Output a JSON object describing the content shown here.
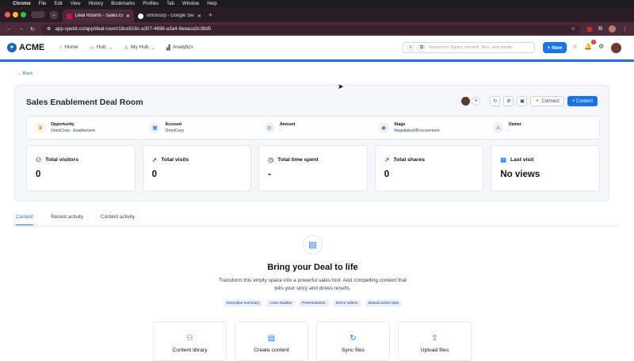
{
  "os_menubar": {
    "app": "Chrome",
    "items": [
      "File",
      "Edit",
      "View",
      "History",
      "Bookmarks",
      "Profiles",
      "Tab",
      "Window",
      "Help"
    ]
  },
  "browser": {
    "tabs": [
      {
        "title": "Deal Rooms - Sales Enableme",
        "active": true
      },
      {
        "title": "omnicorp - Google Search",
        "active": false
      }
    ],
    "url": "app.spekit.co/app/deal-room/18ce518c-a307-4698-a3a4-9eeaca3c38d5"
  },
  "app_nav": {
    "brand": "ACME",
    "items": [
      {
        "label": "Home",
        "icon": "home-icon"
      },
      {
        "label": "Hub",
        "icon": "folder-icon",
        "dropdown": true
      },
      {
        "label": "My Hub",
        "icon": "user-icon",
        "dropdown": true
      },
      {
        "label": "Analytics",
        "icon": "chart-icon"
      }
    ],
    "search_placeholder": "Search for Topics, content, files, and media",
    "new_label": "+ New",
    "notification_count": "1"
  },
  "back_label": "← Back",
  "deal_room": {
    "title": "Sales Enablement Deal Room",
    "connect_label": "Connect",
    "content_label": "+ Content",
    "details": [
      {
        "label": "Opportunity",
        "value": "OmniCorp - Enablement",
        "icon": "crown-icon"
      },
      {
        "label": "Account",
        "value": "OmniCorp",
        "icon": "building-icon"
      },
      {
        "label": "Amount",
        "value": "-",
        "icon": "dollar-icon"
      },
      {
        "label": "Stage",
        "value": "Negotiation/Procurement",
        "icon": "target-icon"
      },
      {
        "label": "Owner",
        "value": "-",
        "icon": "user-icon"
      }
    ],
    "stats": [
      {
        "label": "Total visitors",
        "value": "0",
        "icon": "users-icon"
      },
      {
        "label": "Total visits",
        "value": "0",
        "icon": "cursor-icon"
      },
      {
        "label": "Total time spent",
        "value": "-",
        "icon": "timer-icon"
      },
      {
        "label": "Total shares",
        "value": "0",
        "icon": "share-icon"
      },
      {
        "label": "Last visit",
        "value": "No views",
        "icon": "calendar-icon"
      }
    ]
  },
  "content_tabs": [
    {
      "label": "Content",
      "active": true
    },
    {
      "label": "Recent activity",
      "active": false
    },
    {
      "label": "Content activity",
      "active": false
    }
  ],
  "empty_state": {
    "title": "Bring your Deal to life",
    "description": "Transform this empty space into a powerful sales tool. Add compelling content that tells your story and drives results.",
    "chips": [
      "Executive summary",
      "Case studies",
      "Presentations",
      "Demo videos",
      "Mutual action plan"
    ],
    "cards": [
      {
        "label": "Content library",
        "icon": "library-icon"
      },
      {
        "label": "Create content",
        "icon": "document-icon"
      },
      {
        "label": "Sync files",
        "icon": "sync-icon"
      },
      {
        "label": "Upload files",
        "icon": "upload-icon"
      }
    ]
  },
  "colors": {
    "accent": "#1a73e8",
    "browser_tab": "#4b2a3a"
  }
}
